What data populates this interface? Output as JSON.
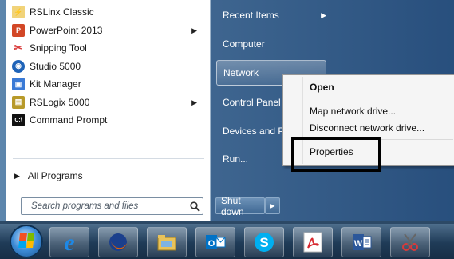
{
  "programs": [
    {
      "label": "RSLinx Classic",
      "icon": "rslinx-icon",
      "has_arrow": false,
      "icon_color": "#c7a036"
    },
    {
      "label": "PowerPoint 2013",
      "icon": "powerpoint-icon",
      "has_arrow": true,
      "icon_color": "#d24726"
    },
    {
      "label": "Snipping Tool",
      "icon": "scissors-icon",
      "has_arrow": false,
      "icon_color": "#d93a3a"
    },
    {
      "label": "Studio 5000",
      "icon": "studio5000-icon",
      "has_arrow": false,
      "icon_color": "#1e63b8"
    },
    {
      "label": "Kit Manager",
      "icon": "kit-manager-icon",
      "has_arrow": false,
      "icon_color": "#3a7ad6"
    },
    {
      "label": "RSLogix 5000",
      "icon": "rslogix-icon",
      "has_arrow": true,
      "icon_color": "#b89a2a"
    },
    {
      "label": "Command Prompt",
      "icon": "command-prompt-icon",
      "has_arrow": false,
      "icon_color": "#111111"
    }
  ],
  "all_programs": "All Programs",
  "search_placeholder": "Search programs and files",
  "right_items": {
    "recent": "Recent Items",
    "computer": "Computer",
    "network": "Network",
    "control_panel": "Control Panel",
    "devices": "Devices and Pr",
    "run": "Run..."
  },
  "shutdown": "Shut down",
  "context_menu": {
    "open": "Open",
    "map": "Map network drive...",
    "disconnect": "Disconnect network drive...",
    "properties": "Properties"
  },
  "taskbar_items": [
    {
      "icon": "internet-explorer-icon",
      "color": "#1e88e5"
    },
    {
      "icon": "firefox-icon",
      "color": "#e66000"
    },
    {
      "icon": "file-explorer-icon",
      "color": "#e8c25a"
    },
    {
      "icon": "outlook-icon",
      "color": "#0072c6"
    },
    {
      "icon": "skype-icon",
      "color": "#00aff0"
    },
    {
      "icon": "acrobat-icon",
      "color": "#d7282f"
    },
    {
      "icon": "word-icon",
      "color": "#2b579a"
    },
    {
      "icon": "snipping-tool-icon",
      "color": "#d93a3a"
    }
  ]
}
